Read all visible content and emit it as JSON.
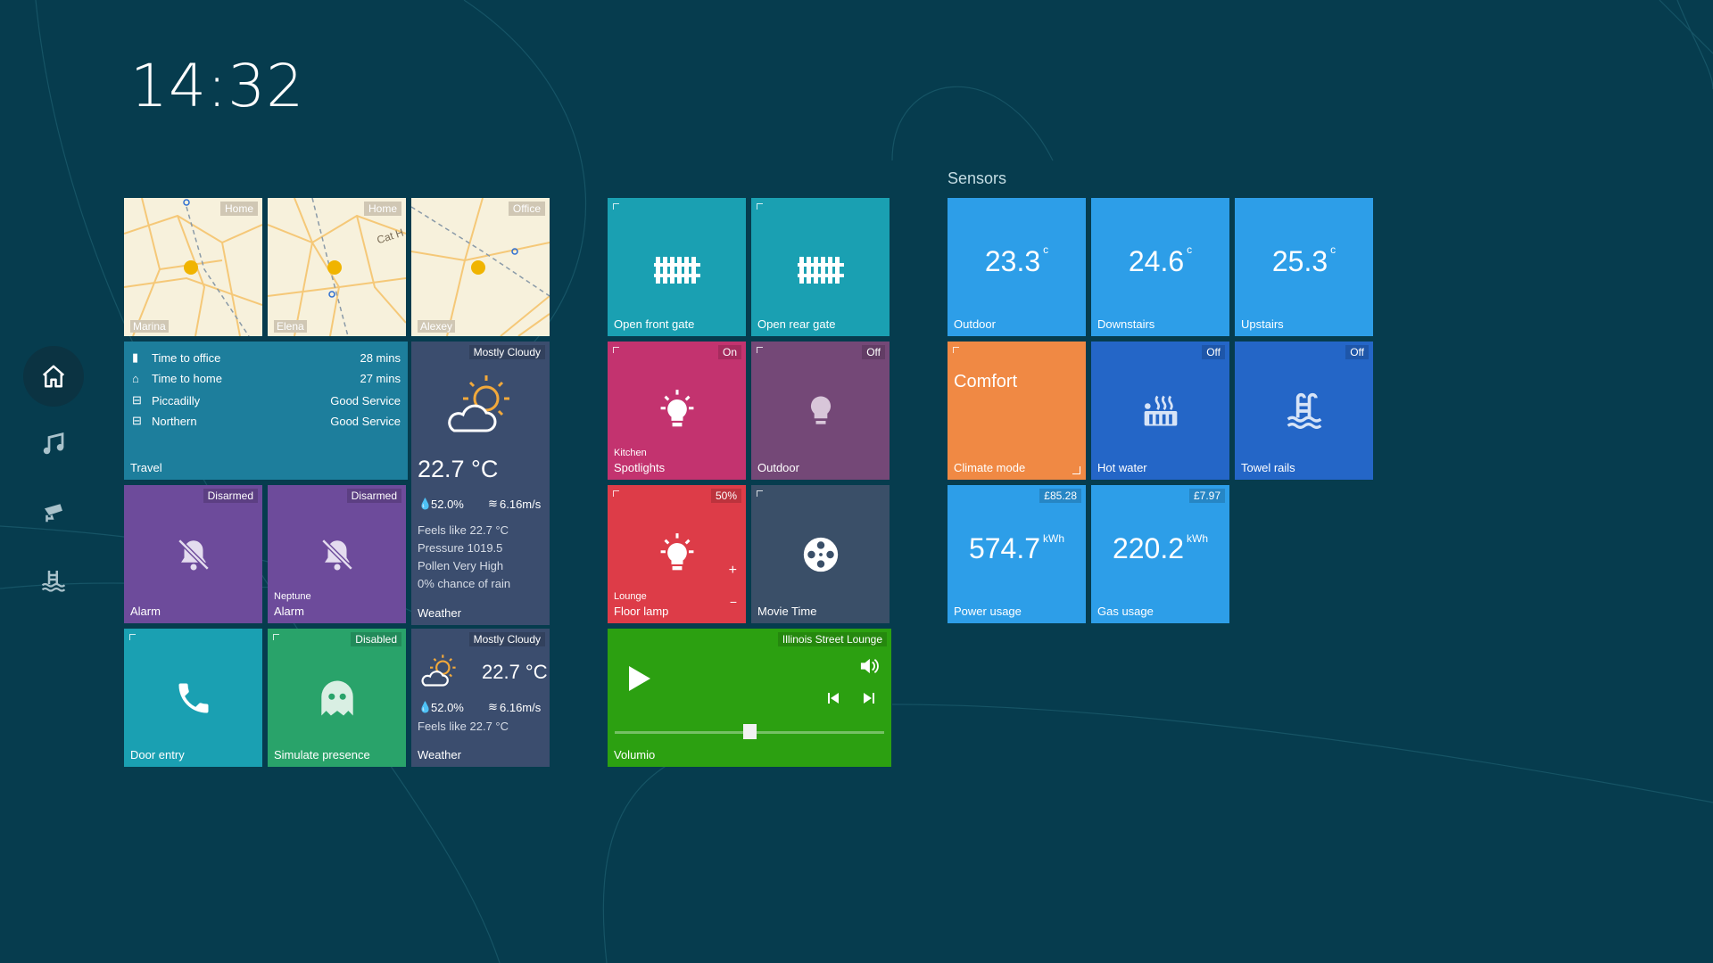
{
  "clock": "14:32",
  "sidebar": {
    "items": [
      {
        "icon": "home-icon"
      },
      {
        "icon": "music-icon"
      },
      {
        "icon": "cctv-icon"
      },
      {
        "icon": "pool-icon"
      }
    ]
  },
  "maps": [
    {
      "place": "Home",
      "person": "Marina"
    },
    {
      "place": "Home",
      "person": "Elena",
      "street": "Cat H"
    },
    {
      "place": "Office",
      "person": "Alexey"
    }
  ],
  "travel": {
    "label": "Travel",
    "rows": [
      {
        "icon": "train-icon",
        "name": "Time to office",
        "value": "28 mins"
      },
      {
        "icon": "home-icon",
        "name": "Time to home",
        "value": "27 mins"
      },
      {
        "icon": "tube-icon",
        "name": "Piccadilly",
        "value": "Good Service"
      },
      {
        "icon": "tube-icon",
        "name": "Northern",
        "value": "Good Service"
      }
    ]
  },
  "weather_big": {
    "condition": "Mostly Cloudy",
    "temp": "22.7 °C",
    "humidity": "52.0%",
    "wind": "6.16m/s",
    "feels": "Feels like 22.7 °C",
    "pressure": "Pressure 1019.5",
    "pollen": "Pollen Very High",
    "rain": "0% chance of rain",
    "label": "Weather"
  },
  "weather_small": {
    "condition": "Mostly Cloudy",
    "temp": "22.7 °C",
    "humidity": "52.0%",
    "wind": "6.16m/s",
    "feels": "Feels like 22.7 °C",
    "label": "Weather"
  },
  "alarms": [
    {
      "state": "Disarmed",
      "sub": "",
      "label": "Alarm"
    },
    {
      "state": "Disarmed",
      "sub": "Neptune",
      "label": "Alarm"
    }
  ],
  "door": {
    "label": "Door entry"
  },
  "presence": {
    "state": "Disabled",
    "label": "Simulate presence"
  },
  "gates": [
    {
      "label": "Open front gate"
    },
    {
      "label": "Open rear gate"
    }
  ],
  "lights": {
    "kitchen": {
      "state": "On",
      "sub": "Kitchen",
      "label": "Spotlights"
    },
    "outdoor": {
      "state": "Off",
      "label": "Outdoor"
    },
    "lounge": {
      "state": "50%",
      "sub": "Lounge",
      "label": "Floor lamp",
      "plus": "+",
      "minus": "−"
    }
  },
  "movie": {
    "label": "Movie Time"
  },
  "player": {
    "room": "Illinois Street Lounge",
    "label": "Volumio",
    "volume": 0.5
  },
  "sensors": {
    "title": "Sensors",
    "temps": [
      {
        "value": "23.3",
        "unit": "c",
        "label": "Outdoor"
      },
      {
        "value": "24.6",
        "unit": "c",
        "label": "Downstairs"
      },
      {
        "value": "25.3",
        "unit": "c",
        "label": "Upstairs"
      }
    ],
    "climate": {
      "mode": "Comfort",
      "label": "Climate mode"
    },
    "hot_water": {
      "state": "Off",
      "label": "Hot water"
    },
    "towel": {
      "state": "Off",
      "label": "Towel rails"
    },
    "power": {
      "cost": "£85.28",
      "value": "574.7",
      "unit": "kWh",
      "label": "Power usage"
    },
    "gas": {
      "cost": "£7.97",
      "value": "220.2",
      "unit": "kWh",
      "label": "Gas usage"
    }
  },
  "colors": {
    "background": "#063c4e",
    "teal": "#1aa0b2",
    "purple": "#6d4b9b",
    "pink": "#c3336f",
    "red": "#dd3c48",
    "green": "#2ca011",
    "blue": "#2d9ee8",
    "orange": "#f08944",
    "dark_blue": "#2466c7"
  }
}
